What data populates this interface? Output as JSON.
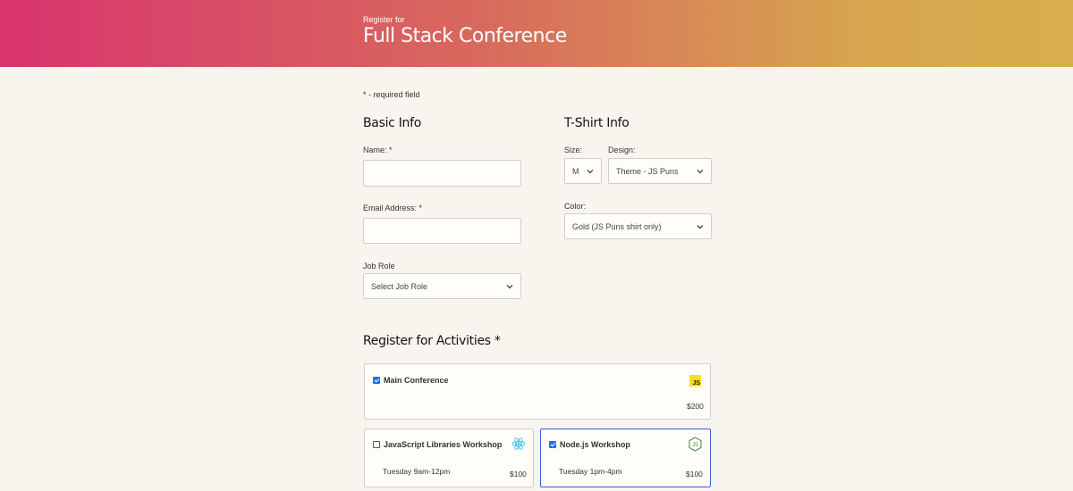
{
  "header": {
    "pre_title": "Register for",
    "title": "Full Stack Conference"
  },
  "required_note": "* - required field",
  "basic_info": {
    "title": "Basic Info",
    "name_label": "Name: *",
    "name_value": "",
    "email_label": "Email Address: *",
    "email_value": "",
    "job_role_label": "Job Role",
    "job_role_selected": "Select Job Role"
  },
  "tshirt_info": {
    "title": "T-Shirt Info",
    "size_label": "Size:",
    "size_selected": "M",
    "design_label": "Design:",
    "design_selected": "Theme - JS Puns",
    "color_label": "Color:",
    "color_selected": "Gold (JS Puns shirt only)"
  },
  "activities": {
    "title": "Register for Activities *",
    "items": [
      {
        "name": "Main Conference",
        "time": "",
        "price": "$200",
        "checked": true,
        "icon": "javascript-icon",
        "icon_text": "JS"
      },
      {
        "name": "JavaScript Libraries Workshop",
        "time": "Tuesday 9am-12pm",
        "price": "$100",
        "checked": false,
        "icon": "react-icon"
      },
      {
        "name": "Node.js Workshop",
        "time": "Tuesday 1pm-4pm",
        "price": "$100",
        "checked": true,
        "icon": "nodejs-icon"
      }
    ]
  },
  "colors": {
    "header_gradient_start": "#d9346e",
    "header_gradient_end": "#d8ae4c",
    "background": "#f8f5ef",
    "selected_border": "#3b5bdb",
    "checkbox_checked": "#1a73e8"
  }
}
